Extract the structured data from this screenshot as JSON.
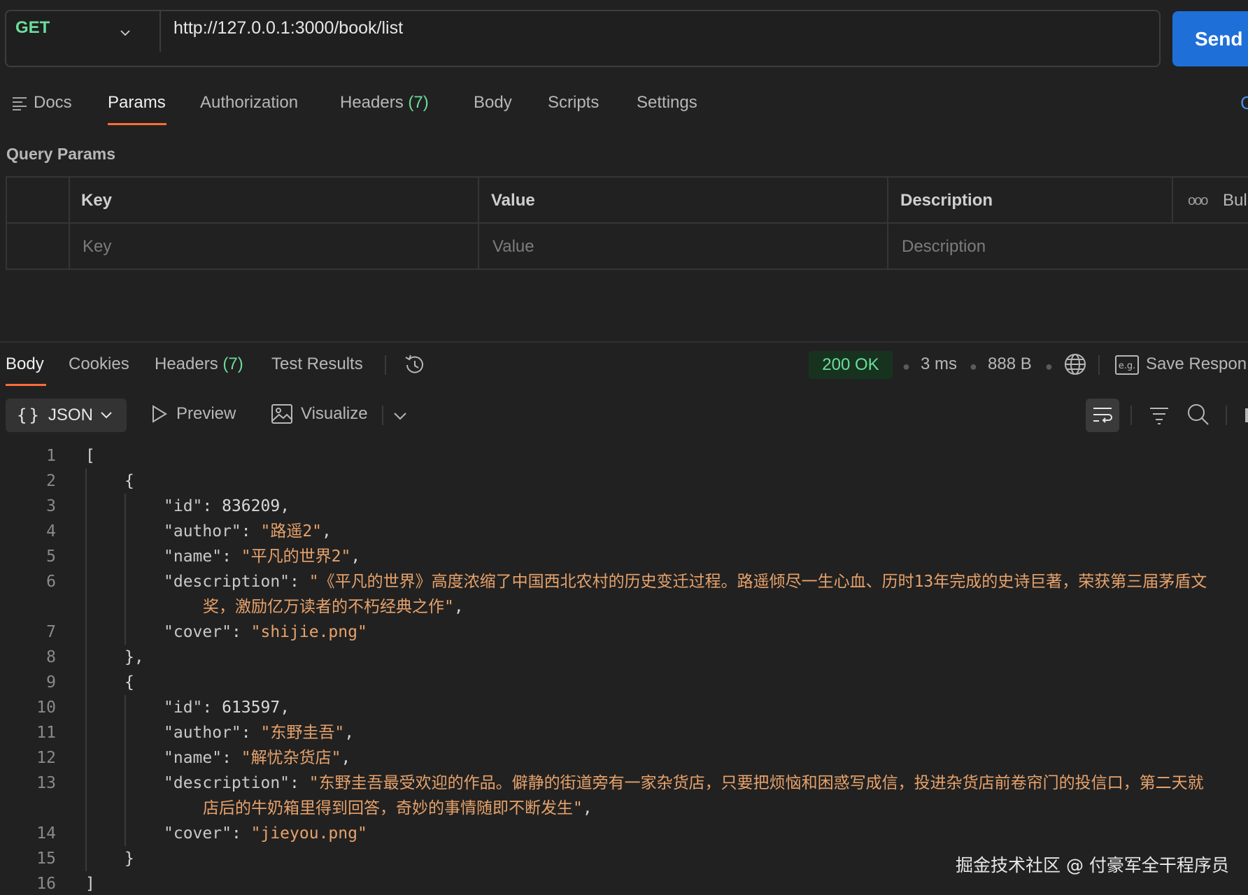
{
  "request": {
    "method": "GET",
    "url": "http://127.0.0.1:3000/book/list",
    "send_label": "Send"
  },
  "request_tabs": {
    "docs": "Docs",
    "params": "Params",
    "authorization": "Authorization",
    "headers": "Headers",
    "headers_count": "(7)",
    "body": "Body",
    "scripts": "Scripts",
    "settings": "Settings",
    "cut_link": "C"
  },
  "query_params": {
    "title": "Query Params",
    "columns": [
      "Key",
      "Value",
      "Description"
    ],
    "bulk_edit": "Bul",
    "placeholders": [
      "Key",
      "Value",
      "Description"
    ]
  },
  "response_tabs": {
    "body": "Body",
    "cookies": "Cookies",
    "headers": "Headers",
    "headers_count": "(7)",
    "test_results": "Test Results"
  },
  "response_meta": {
    "status": "200 OK",
    "time": "3 ms",
    "size": "888 B",
    "save_response": "Save Respon",
    "status_color": "#6bdd9a",
    "accent_color": "#ff6c37",
    "send_color": "#1f6fd9"
  },
  "response_toolbar": {
    "format": "JSON",
    "preview": "Preview",
    "visualize": "Visualize"
  },
  "code_lines": [
    {
      "n": "1",
      "t": "["
    },
    {
      "n": "2",
      "t": "{"
    },
    {
      "n": "3",
      "k": "\"id\"",
      "sep": ": ",
      "v": "836209",
      "end": ","
    },
    {
      "n": "4",
      "k": "\"author\"",
      "sep": ": ",
      "v": "\"路遥2\"",
      "end": ","
    },
    {
      "n": "5",
      "k": "\"name\"",
      "sep": ": ",
      "v": "\"平凡的世界2\"",
      "end": ","
    },
    {
      "n": "6",
      "k": "\"description\"",
      "sep": ": ",
      "v": "\"《平凡的世界》高度浓缩了中国西北农村的历史变迁过程。路遥倾尽一生心血、历时13年完成的史诗巨著，荣获第三届茅盾文"
    },
    {
      "n": "",
      "v": "奖，激励亿万读者的不朽经典之作\"",
      "end": ","
    },
    {
      "n": "7",
      "k": "\"cover\"",
      "sep": ": ",
      "v": "\"shijie.png\""
    },
    {
      "n": "8",
      "t": "},"
    },
    {
      "n": "9",
      "t": "{"
    },
    {
      "n": "10",
      "k": "\"id\"",
      "sep": ": ",
      "v": "613597",
      "end": ","
    },
    {
      "n": "11",
      "k": "\"author\"",
      "sep": ": ",
      "v": "\"东野圭吾\"",
      "end": ","
    },
    {
      "n": "12",
      "k": "\"name\"",
      "sep": ": ",
      "v": "\"解忧杂货店\"",
      "end": ","
    },
    {
      "n": "13",
      "k": "\"description\"",
      "sep": ": ",
      "v": "\"东野圭吾最受欢迎的作品。僻静的街道旁有一家杂货店，只要把烦恼和困惑写成信，投进杂货店前卷帘门的投信口，第二天就"
    },
    {
      "n": "",
      "v": "店后的牛奶箱里得到回答，奇妙的事情随即不断发生\"",
      "end": ","
    },
    {
      "n": "14",
      "k": "\"cover\"",
      "sep": ": ",
      "v": "\"jieyou.png\""
    },
    {
      "n": "15",
      "t": "}"
    },
    {
      "n": "16",
      "t": "]"
    }
  ],
  "watermark": "掘金技术社区 @ 付豪军全干程序员"
}
